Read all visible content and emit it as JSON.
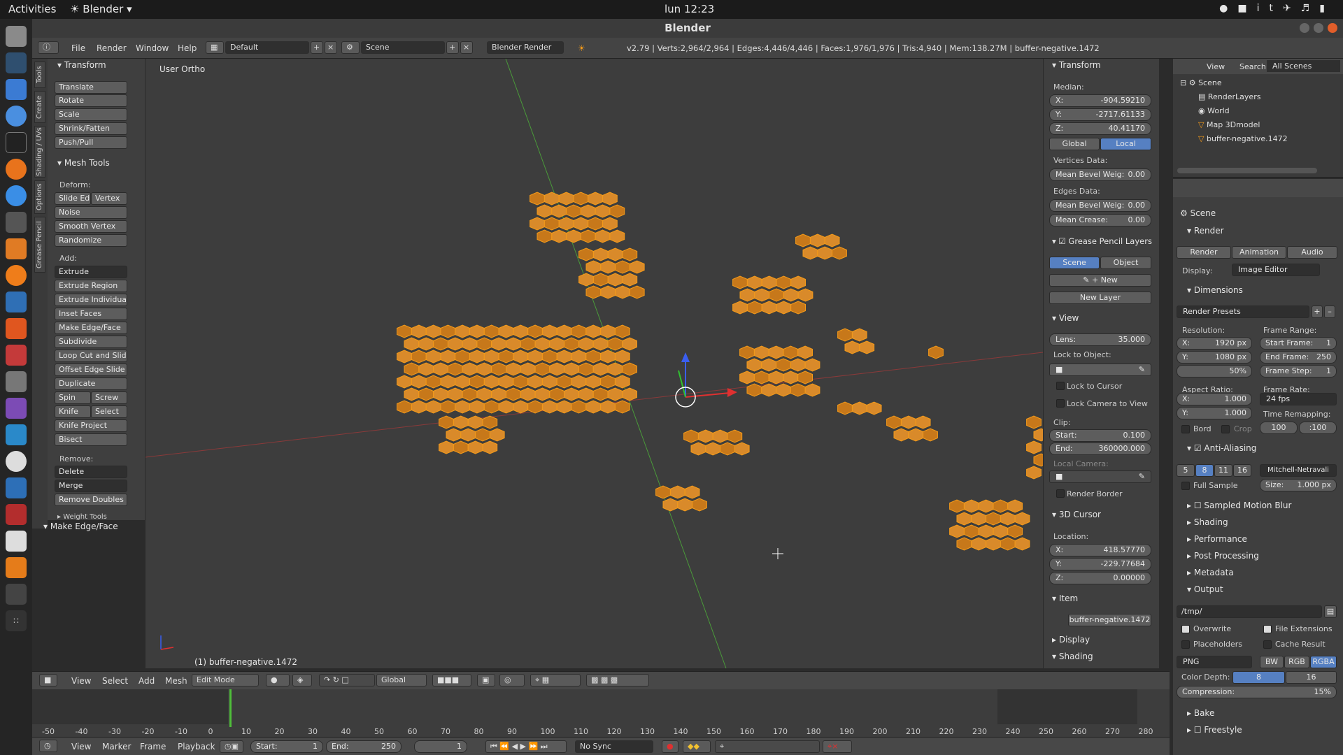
{
  "topbar": {
    "activities": "Activities",
    "app": "Blender",
    "clock": "lun 12:23",
    "lang": "it"
  },
  "window": {
    "title": "Blender"
  },
  "info": {
    "menus": [
      "File",
      "Render",
      "Window",
      "Help"
    ],
    "layout": "Default",
    "scene": "Scene",
    "engine": "Blender Render",
    "stats": "v2.79 | Verts:2,964/2,964 | Edges:4,446/4,446 | Faces:1,976/1,976 | Tris:4,940 | Mem:138.27M | buffer-negative.1472"
  },
  "lefttabs": [
    "Tools",
    "Create",
    "Shading / UVs",
    "Options",
    "Grease Pencil"
  ],
  "tools": {
    "transform_header": "Transform",
    "transform": [
      "Translate",
      "Rotate",
      "Scale",
      "Shrink/Fatten",
      "Push/Pull"
    ],
    "meshtools_header": "Mesh Tools",
    "deform_label": "Deform:",
    "slide_edge": "Slide Ed",
    "vertex": "Vertex",
    "deform": [
      "Noise",
      "Smooth Vertex",
      "Randomize"
    ],
    "add_label": "Add:",
    "extrude": "Extrude",
    "add": [
      "Extrude Region",
      "Extrude Individual",
      "Inset Faces",
      "Make Edge/Face",
      "Subdivide",
      "Loop Cut and Slide",
      "Offset Edge Slide",
      "Duplicate"
    ],
    "spin": "Spin",
    "screw": "Screw",
    "knife": "Knife",
    "select": "Select",
    "knife_project": "Knife Project",
    "bisect": "Bisect",
    "remove_label": "Remove:",
    "delete": "Delete",
    "merge": "Merge",
    "remove_doubles": "Remove Doubles",
    "weight_tools": "Weight Tools",
    "last_op": "Make Edge/Face"
  },
  "viewport": {
    "label": "User Ortho",
    "object": "(1) buffer-negative.1472"
  },
  "npanel": {
    "transform": "Transform",
    "median": "Median:",
    "x": "-904.59210",
    "y": "-2717.61133",
    "z": "40.41170",
    "global": "Global",
    "local": "Local",
    "vertices_data": "Vertices Data:",
    "mean_bevel_v": "0.00",
    "edges_data": "Edges Data:",
    "mean_bevel_e": "0.00",
    "mean_crease": "0.00",
    "mean_bevel_label": "Mean Bevel Weig:",
    "mean_crease_label": "Mean Crease:",
    "gp_layers": "Grease Pencil Layers",
    "scene": "Scene",
    "object": "Object",
    "new": "New",
    "new_layer": "New Layer",
    "view": "View",
    "lens_label": "Lens:",
    "lens": "35.000",
    "lock_object": "Lock to Object:",
    "lock_cursor": "Lock to Cursor",
    "lock_camera": "Lock Camera to View",
    "clip": "Clip:",
    "start_label": "Start:",
    "start": "0.100",
    "end_label": "End:",
    "end": "360000.000",
    "local_camera": "Local Camera:",
    "render_border": "Render Border",
    "cursor": "3D Cursor",
    "location": "Location:",
    "cx": "418.57770",
    "cy": "-229.77684",
    "cz": "0.00000",
    "item": "Item",
    "item_name": "buffer-negative.1472",
    "display": "Display",
    "shading": "Shading"
  },
  "outliner": {
    "view": "View",
    "search": "Search",
    "filter": "All Scenes",
    "items": [
      "Scene",
      "RenderLayers",
      "World",
      "Map 3Dmodel",
      "buffer-negative.1472"
    ]
  },
  "props": {
    "scene": "Scene",
    "render": "Render",
    "render_btn": "Render",
    "animation_btn": "Animation",
    "audio_btn": "Audio",
    "display_label": "Display:",
    "display": "Image Editor",
    "dimensions": "Dimensions",
    "presets": "Render Presets",
    "resolution": "Resolution:",
    "res_x": "1920 px",
    "res_y": "1080 px",
    "res_pct": "50%",
    "frame_range": "Frame Range:",
    "start_frame_label": "Start Frame:",
    "start_frame": "1",
    "end_frame_label": "End Frame:",
    "end_frame": "250",
    "frame_step_label": "Frame Step:",
    "frame_step": "1",
    "aspect": "Aspect Ratio:",
    "asp_x": "1.000",
    "asp_y": "1.000",
    "frame_rate": "Frame Rate:",
    "fps": "24 fps",
    "time_remap": "Time Remapping:",
    "remap_old": "100",
    "remap_new": ":100",
    "bord": "Bord",
    "crop": "Crop",
    "aa": "Anti-Aliasing",
    "aa_levels": [
      "5",
      "8",
      "11",
      "16"
    ],
    "filter": "Mitchell-Netravali",
    "full_sample": "Full Sample",
    "size_label": "Size:",
    "size": "1.000 px",
    "motion_blur": "Sampled Motion Blur",
    "shading": "Shading",
    "performance": "Performance",
    "post": "Post Processing",
    "metadata": "Metadata",
    "output": "Output",
    "path": "/tmp/",
    "overwrite": "Overwrite",
    "file_ext": "File Extensions",
    "placeholders": "Placeholders",
    "cache": "Cache Result",
    "format": "PNG",
    "bw": "BW",
    "rgb": "RGB",
    "rgba": "RGBA",
    "color_depth": "Color Depth:",
    "cd8": "8",
    "cd16": "16",
    "compression_label": "Compression:",
    "compression": "15%",
    "bake": "Bake",
    "freestyle": "Freestyle"
  },
  "vheader": {
    "view": "View",
    "select": "Select",
    "add": "Add",
    "mesh": "Mesh",
    "mode": "Edit Mode",
    "orientation": "Global"
  },
  "timeline": {
    "ticks": [
      "-50",
      "-40",
      "-30",
      "-20",
      "-10",
      "0",
      "10",
      "20",
      "30",
      "40",
      "50",
      "60",
      "70",
      "80",
      "90",
      "100",
      "110",
      "120",
      "130",
      "140",
      "150",
      "160",
      "170",
      "180",
      "190",
      "200",
      "210",
      "220",
      "230",
      "240",
      "250",
      "260",
      "270",
      "280"
    ],
    "view": "View",
    "marker": "Marker",
    "frame": "Frame",
    "playback": "Playback",
    "start_label": "Start:",
    "start": "1",
    "end_label": "End:",
    "end": "250",
    "current": "1",
    "sync": "No Sync"
  },
  "colors": {
    "selected_mesh": "#f39a1a",
    "accent": "#5680c2",
    "viewport_bg": "#3d3d3d"
  }
}
